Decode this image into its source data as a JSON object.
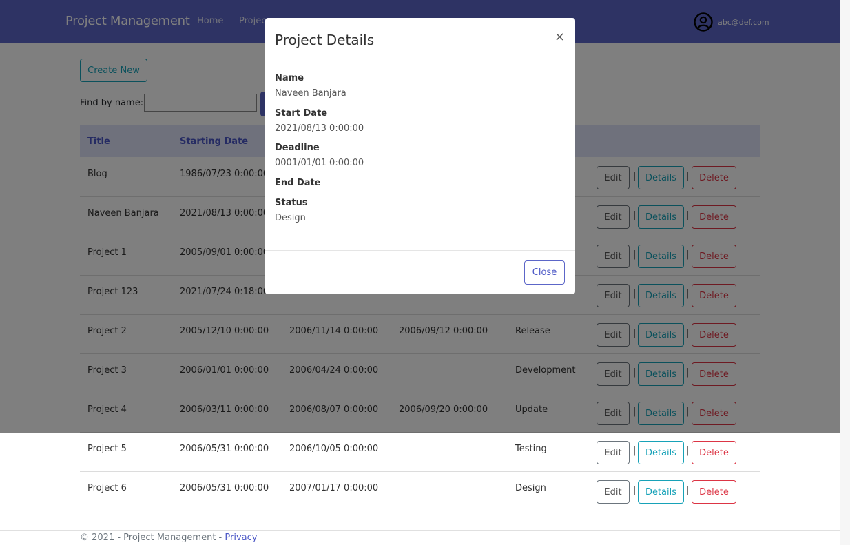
{
  "navbar": {
    "brand": "Project Management",
    "home": "Home",
    "projects": "Projec",
    "user_email": "abc@def.com",
    "user_icon": "user-circle-icon"
  },
  "page": {
    "create_new": "Create New",
    "find_label": "Find by name:",
    "find_value": ""
  },
  "table": {
    "headers": [
      "Title",
      "Starting Date"
    ],
    "actions": {
      "edit": "Edit",
      "details": "Details",
      "delete": "Delete",
      "separator": "|"
    },
    "rows": [
      {
        "title": "Blog",
        "start": "1986/07/23 0:00:00",
        "deadline": "",
        "end": "",
        "status": ""
      },
      {
        "title": "Naveen Banjara",
        "start": "2021/08/13 0:00:00",
        "deadline": "",
        "end": "",
        "status": ""
      },
      {
        "title": "Project 1",
        "start": "2005/09/01 0:00:00",
        "deadline": "",
        "end": "",
        "status": ""
      },
      {
        "title": "Project 123",
        "start": "2021/07/24 0:18:00",
        "deadline": "",
        "end": "",
        "status": ""
      },
      {
        "title": "Project 2",
        "start": "2005/12/10 0:00:00",
        "deadline": "2006/11/14 0:00:00",
        "end": "2006/09/12 0:00:00",
        "status": "Release"
      },
      {
        "title": "Project 3",
        "start": "2006/01/01 0:00:00",
        "deadline": "2006/04/24 0:00:00",
        "end": "",
        "status": "Development"
      },
      {
        "title": "Project 4",
        "start": "2006/03/11 0:00:00",
        "deadline": "2006/08/07 0:00:00",
        "end": "2006/09/20 0:00:00",
        "status": "Update"
      },
      {
        "title": "Project 5",
        "start": "2006/05/31 0:00:00",
        "deadline": "2006/10/05 0:00:00",
        "end": "",
        "status": "Testing"
      },
      {
        "title": "Project 6",
        "start": "2006/05/31 0:00:00",
        "deadline": "2007/01/17 0:00:00",
        "end": "",
        "status": "Design"
      }
    ]
  },
  "footer": {
    "text": "© 2021 - Project Management - ",
    "privacy": "Privacy"
  },
  "modal": {
    "title": "Project Details",
    "close_x": "×",
    "fields": [
      {
        "label": "Name",
        "value": "Naveen Banjara"
      },
      {
        "label": "Start Date",
        "value": "2021/08/13 0:00:00"
      },
      {
        "label": "Deadline",
        "value": "0001/01/01 0:00:00"
      },
      {
        "label": "End Date",
        "value": ""
      },
      {
        "label": "Status",
        "value": "Design"
      }
    ],
    "close_button": "Close"
  },
  "colors": {
    "navbar": "#5c66c8",
    "info": "#17a2b8",
    "danger": "#dc3545",
    "secondary": "#6c757d",
    "table_header": "#dfe2f8"
  }
}
